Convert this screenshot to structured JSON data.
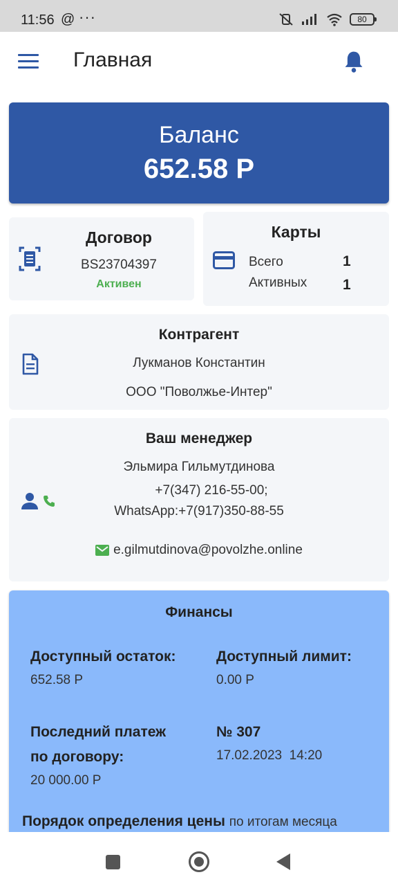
{
  "status_bar": {
    "time": "11:56",
    "at_symbol": "@",
    "more": "···",
    "battery": "80"
  },
  "app_bar": {
    "title": "Главная"
  },
  "balance": {
    "label": "Баланс",
    "value": "652.58 Р"
  },
  "contract": {
    "title": "Договор",
    "number": "BS23704397",
    "status": "Активен"
  },
  "cards": {
    "title": "Карты",
    "rows": [
      {
        "label": "Всего",
        "value": "1"
      },
      {
        "label": "Активных",
        "value": "1"
      }
    ]
  },
  "counterparty": {
    "title": "Контрагент",
    "person": "Лукманов Константин",
    "company": "ООО \"Поволжье-Интер\""
  },
  "manager": {
    "title": "Ваш менеджер",
    "name": "Эльмира Гильмутдинова",
    "phone_line1": "+7(347) 216-55-00;",
    "phone_line2": "WhatsApp:+7(917)350-88-55",
    "email": "e.gilmutdinova@povolzhe.online"
  },
  "finance": {
    "title": "Финансы",
    "available_balance_label": "Доступный остаток:",
    "available_balance_value": "652.58 Р",
    "available_limit_label": "Доступный лимит:",
    "available_limit_value": "0.00 Р",
    "last_payment_label_1": "Последний платеж",
    "last_payment_label_2": "по договору:",
    "last_payment_value": "20 000.00 Р",
    "payment_number": "№ 307",
    "payment_datetime": "17.02.2023  14:20",
    "pricing_label": "Порядок определения цены",
    "pricing_value": "по итогам месяца"
  },
  "colors": {
    "primary": "#2f58a5",
    "finance_bg": "#8ab9fb",
    "card_bg": "#f4f6f9",
    "active_green": "#4caf50"
  },
  "icons": {
    "menu": "hamburger-icon",
    "bell": "bell-icon",
    "contract": "document-scan-icon",
    "cards": "credit-card-icon",
    "counterparty": "document-icon",
    "manager": "person-icon",
    "phone": "phone-icon",
    "email": "email-icon"
  }
}
